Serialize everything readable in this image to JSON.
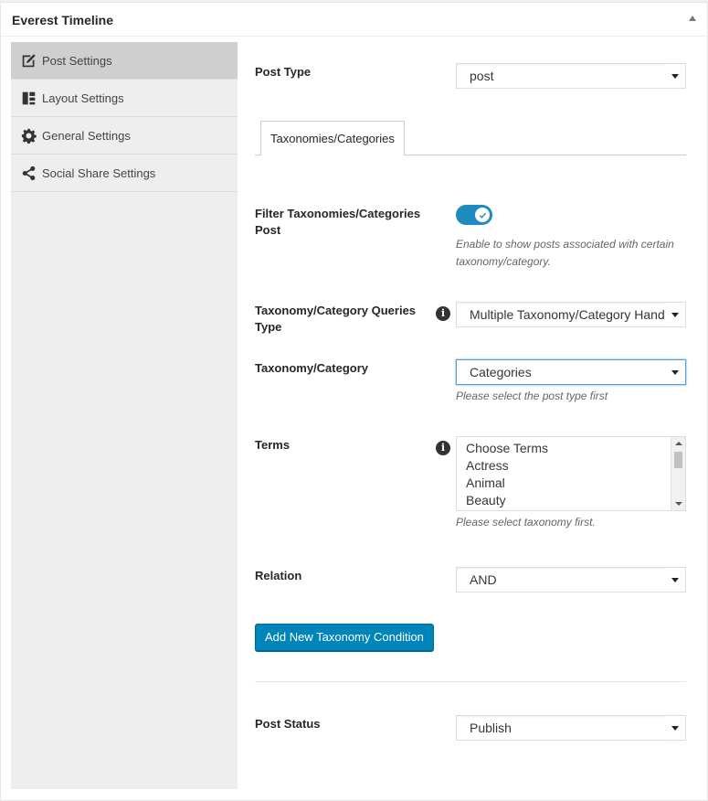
{
  "metabox": {
    "title": "Everest Timeline"
  },
  "sidebar": {
    "items": [
      {
        "label": "Post Settings",
        "icon": "edit-icon",
        "active": true
      },
      {
        "label": "Layout Settings",
        "icon": "layout-icon"
      },
      {
        "label": "General Settings",
        "icon": "gear-icon"
      },
      {
        "label": "Social Share Settings",
        "icon": "share-icon"
      }
    ]
  },
  "post_type": {
    "label": "Post Type",
    "value": "post"
  },
  "tabs": [
    {
      "label": "Taxonomies/Categories"
    }
  ],
  "filter": {
    "label": "Filter Taxonomies/Categories Post",
    "enabled": true,
    "description": "Enable to show posts associated with certain taxonomy/category."
  },
  "query_type": {
    "label": "Taxonomy/Category Queries Type",
    "value": "Multiple Taxonomy/Category Handler"
  },
  "taxonomy": {
    "label": "Taxonomy/Category",
    "value": "Categories",
    "hint": "Please select the post type first"
  },
  "terms": {
    "label": "Terms",
    "options": [
      "Choose Terms",
      "Actress",
      "Animal",
      "Beauty"
    ],
    "hint": "Please select taxonomy first."
  },
  "relation": {
    "label": "Relation",
    "value": "AND"
  },
  "add_condition_button": "Add New Taxonomy Condition",
  "post_status": {
    "label": "Post Status",
    "value": "Publish"
  },
  "colors": {
    "accent": "#0085ba",
    "toggle": "#1e8cbe",
    "sidebar_active": "#cfcfcf"
  }
}
